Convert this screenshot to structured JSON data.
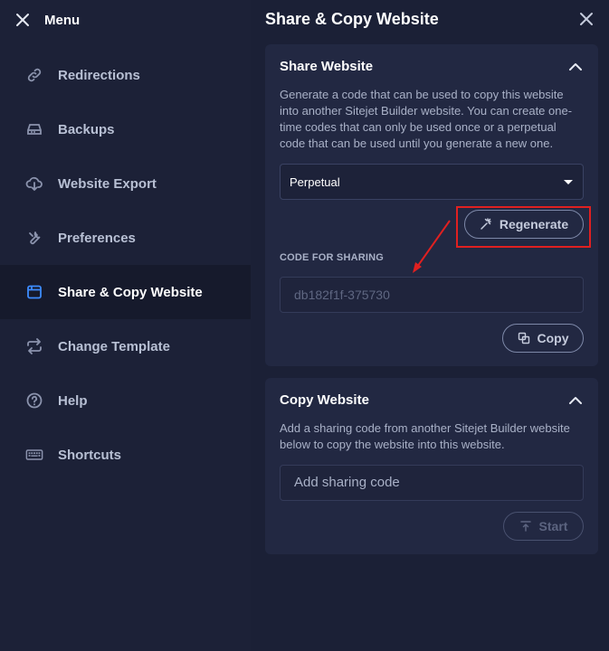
{
  "sidebar": {
    "title": "Menu",
    "items": [
      {
        "label": "Redirections",
        "icon": "link-icon"
      },
      {
        "label": "Backups",
        "icon": "drive-icon"
      },
      {
        "label": "Website Export",
        "icon": "cloud-download-icon"
      },
      {
        "label": "Preferences",
        "icon": "wrench-icon"
      },
      {
        "label": "Share & Copy Website",
        "icon": "window-icon",
        "active": true
      },
      {
        "label": "Change Template",
        "icon": "swap-arrows-icon"
      },
      {
        "label": "Help",
        "icon": "help-circle-icon"
      },
      {
        "label": "Shortcuts",
        "icon": "keyboard-icon"
      }
    ]
  },
  "panel": {
    "title": "Share & Copy Website",
    "share_card": {
      "title": "Share Website",
      "description": "Generate a code that can be used to copy this website into another Sitejet Builder website. You can create one-time codes that can only be used once or a perpetual code that can be used until you generate a new one.",
      "code_type": "Perpetual",
      "regenerate_label": "Regenerate",
      "code_label": "CODE FOR SHARING",
      "code_value": "db182f1f-375730",
      "copy_label": "Copy"
    },
    "copy_card": {
      "title": "Copy Website",
      "description": "Add a sharing code from another Sitejet Builder website below to copy the website into this website.",
      "input_placeholder": "Add sharing code",
      "start_label": "Start"
    }
  },
  "colors": {
    "background": "#1b2036",
    "card": "#222842",
    "active_item": "#161a2c",
    "accent_blue": "#3d8bfd",
    "annotation_red": "#e02020"
  }
}
